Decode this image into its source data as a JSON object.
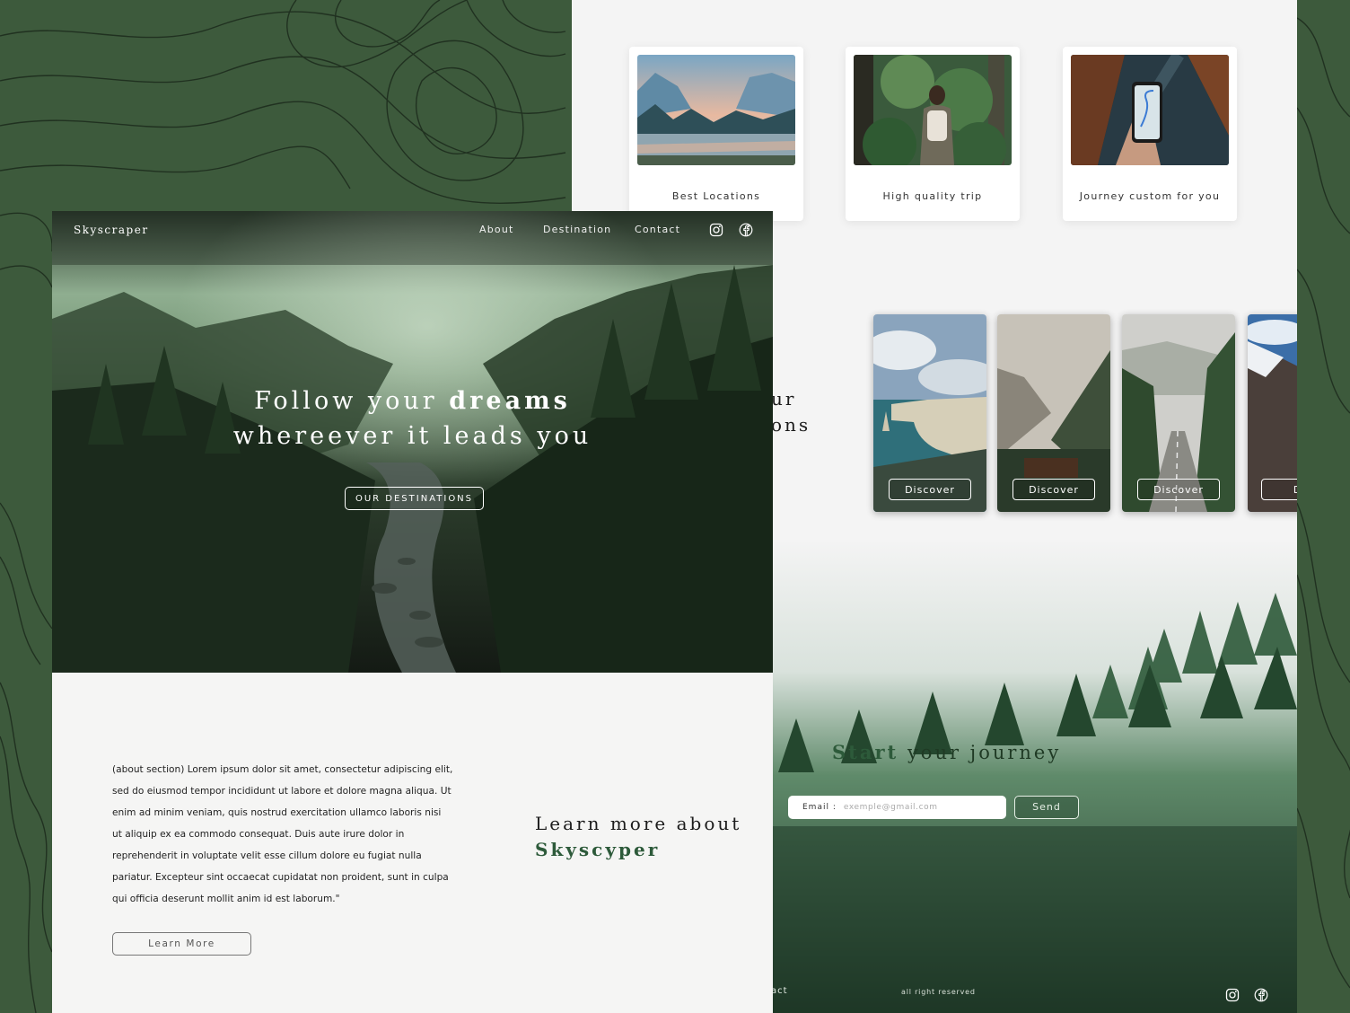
{
  "colors": {
    "background_green": "#3d5a3c",
    "accent_green": "#2d5a3a",
    "page_bg": "#f5f5f4"
  },
  "back_page": {
    "features": [
      {
        "label": "Best Locations"
      },
      {
        "label": "High quality trip"
      },
      {
        "label": "Journey custom for you"
      }
    ],
    "partial_heading": {
      "line1": "ur",
      "line2": "ons"
    },
    "destinations": [
      {
        "button": "Discover"
      },
      {
        "button": "Discover"
      },
      {
        "button": "Discover"
      },
      {
        "button": "Dis"
      }
    ],
    "journey": {
      "title_accent": "Start",
      "title_rest": "your journey"
    },
    "newsletter": {
      "email_label": "Email :",
      "email_placeholder": "exemple@gmail.com",
      "send_label": "Send"
    },
    "footer": {
      "partial_link": "act",
      "copyright": "all right reserved",
      "icons": [
        "instagram-icon",
        "facebook-icon"
      ]
    }
  },
  "front_page": {
    "nav": {
      "logo": "Skyscraper",
      "links": [
        "About",
        "Destination",
        "Contact"
      ],
      "icons": [
        "instagram-icon",
        "facebook-icon"
      ]
    },
    "hero": {
      "line1_prefix": "Follow your",
      "line1_bold": "dreams",
      "line2": "whereever it leads you",
      "button": "OUR DESTINATIONS"
    },
    "about": {
      "text": "(about section) Lorem ipsum dolor sit amet, consectetur adipiscing elit, sed do eiusmod tempor incididunt ut labore et dolore magna aliqua. Ut enim ad minim veniam, quis nostrud exercitation ullamco laboris nisi ut aliquip ex ea commodo consequat. Duis aute irure dolor in reprehenderit in voluptate velit esse cillum dolore eu fugiat nulla pariatur. Excepteur sint occaecat cupidatat non proident, sunt in culpa qui officia deserunt mollit anim id est laborum.\"",
      "button": "Learn More",
      "title_line1": "Learn more about",
      "title_line2": "Skyscyper"
    }
  }
}
